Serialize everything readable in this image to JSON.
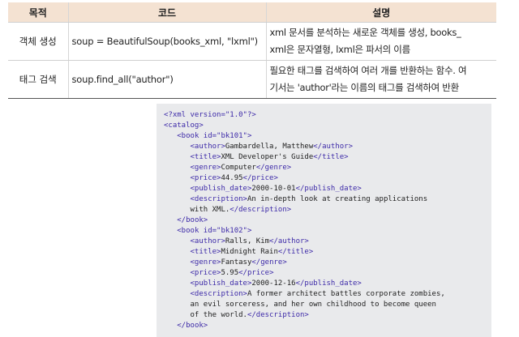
{
  "table": {
    "headers": [
      "목적",
      "코드",
      "설명"
    ],
    "rows": [
      {
        "purpose": "객체 생성",
        "code": "soup = BeautifulSoup(books_xml, \"lxml\")",
        "desc_line1": "xml 문서를 분석하는 새로운 객체를 생성, books_",
        "desc_line2": "xml은 문자열형, lxml은 파서의 이름"
      },
      {
        "purpose": "태그 검색",
        "code": "soup.find_all(\"author\")",
        "desc_line1": "필요한 태그를 검색하여 여러 개를 반환하는 함수. 여",
        "desc_line2": "기서는 'author'라는 이름의 태그를 검색하여 반환"
      }
    ]
  },
  "code_block": {
    "lines": [
      {
        "indent": "",
        "parts": [
          {
            "t": "tag",
            "v": "<?xml version=\"1.0\"?>"
          }
        ]
      },
      {
        "indent": "",
        "parts": [
          {
            "t": "tag",
            "v": "<catalog>"
          }
        ]
      },
      {
        "indent": "   ",
        "parts": [
          {
            "t": "tag",
            "v": "<book id=\"bk101\">"
          }
        ]
      },
      {
        "indent": "      ",
        "parts": [
          {
            "t": "tag",
            "v": "<author>"
          },
          {
            "t": "txt",
            "v": "Gambardella, Matthew"
          },
          {
            "t": "tag",
            "v": "</author>"
          }
        ]
      },
      {
        "indent": "      ",
        "parts": [
          {
            "t": "tag",
            "v": "<title>"
          },
          {
            "t": "txt",
            "v": "XML Developer's Guide"
          },
          {
            "t": "tag",
            "v": "</title>"
          }
        ]
      },
      {
        "indent": "      ",
        "parts": [
          {
            "t": "tag",
            "v": "<genre>"
          },
          {
            "t": "txt",
            "v": "Computer"
          },
          {
            "t": "tag",
            "v": "</genre>"
          }
        ]
      },
      {
        "indent": "      ",
        "parts": [
          {
            "t": "tag",
            "v": "<price>"
          },
          {
            "t": "txt",
            "v": "44.95"
          },
          {
            "t": "tag",
            "v": "</price>"
          }
        ]
      },
      {
        "indent": "      ",
        "parts": [
          {
            "t": "tag",
            "v": "<publish_date>"
          },
          {
            "t": "txt",
            "v": "2000-10-01"
          },
          {
            "t": "tag",
            "v": "</publish_date>"
          }
        ]
      },
      {
        "indent": "      ",
        "parts": [
          {
            "t": "tag",
            "v": "<description>"
          },
          {
            "t": "txt",
            "v": "An in-depth look at creating applications"
          }
        ]
      },
      {
        "indent": "      ",
        "parts": [
          {
            "t": "txt",
            "v": "with XML."
          },
          {
            "t": "tag",
            "v": "</description>"
          }
        ]
      },
      {
        "indent": "   ",
        "parts": [
          {
            "t": "tag",
            "v": "</book>"
          }
        ]
      },
      {
        "indent": "   ",
        "parts": [
          {
            "t": "tag",
            "v": "<book id=\"bk102\">"
          }
        ]
      },
      {
        "indent": "      ",
        "parts": [
          {
            "t": "tag",
            "v": "<author>"
          },
          {
            "t": "txt",
            "v": "Ralls, Kim"
          },
          {
            "t": "tag",
            "v": "</author>"
          }
        ]
      },
      {
        "indent": "      ",
        "parts": [
          {
            "t": "tag",
            "v": "<title>"
          },
          {
            "t": "txt",
            "v": "Midnight Rain"
          },
          {
            "t": "tag",
            "v": "</title>"
          }
        ]
      },
      {
        "indent": "      ",
        "parts": [
          {
            "t": "tag",
            "v": "<genre>"
          },
          {
            "t": "txt",
            "v": "Fantasy"
          },
          {
            "t": "tag",
            "v": "</genre>"
          }
        ]
      },
      {
        "indent": "      ",
        "parts": [
          {
            "t": "tag",
            "v": "<price>"
          },
          {
            "t": "txt",
            "v": "5.95"
          },
          {
            "t": "tag",
            "v": "</price>"
          }
        ]
      },
      {
        "indent": "      ",
        "parts": [
          {
            "t": "tag",
            "v": "<publish_date>"
          },
          {
            "t": "txt",
            "v": "2000-12-16"
          },
          {
            "t": "tag",
            "v": "</publish_date>"
          }
        ]
      },
      {
        "indent": "      ",
        "parts": [
          {
            "t": "tag",
            "v": "<description>"
          },
          {
            "t": "txt",
            "v": "A former architect battles corporate zombies,"
          }
        ]
      },
      {
        "indent": "      ",
        "parts": [
          {
            "t": "txt",
            "v": "an evil sorceress, and her own childhood to become queen"
          }
        ]
      },
      {
        "indent": "      ",
        "parts": [
          {
            "t": "txt",
            "v": "of the world."
          },
          {
            "t": "tag",
            "v": "</description>"
          }
        ]
      },
      {
        "indent": "   ",
        "parts": [
          {
            "t": "tag",
            "v": "</book>"
          }
        ]
      }
    ]
  },
  "colors": {
    "header_bg": "#f4e2d2",
    "code_bg": "#e9eaec",
    "code_tag": "#3d2aa8",
    "code_text": "#222222"
  }
}
